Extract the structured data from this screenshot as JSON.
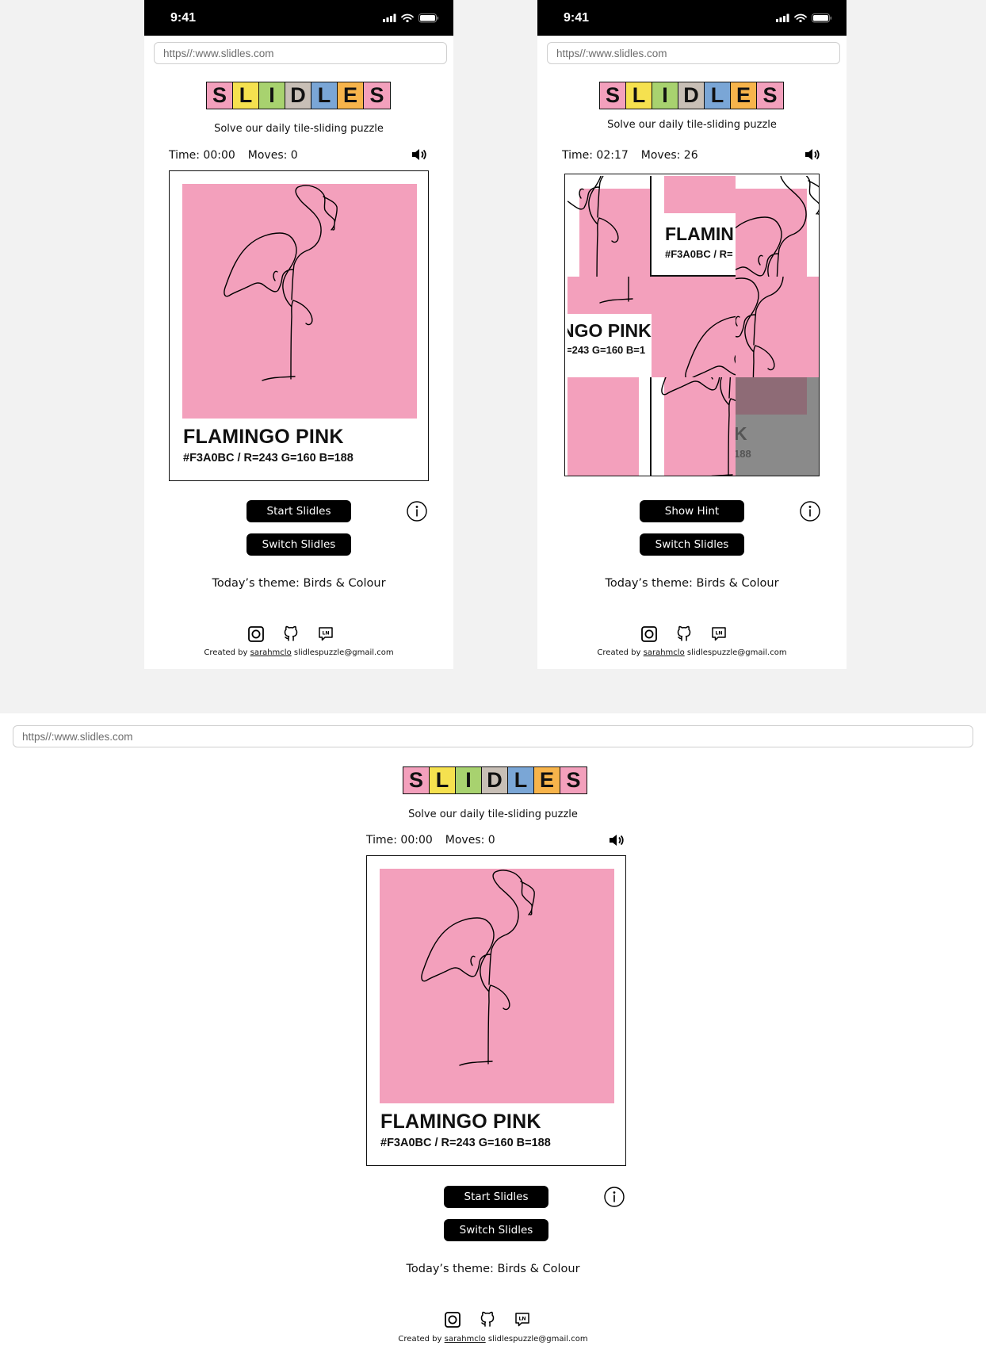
{
  "status": {
    "time": "9:41"
  },
  "url": "https//:www.slidles.com",
  "logo": [
    "S",
    "L",
    "I",
    "D",
    "L",
    "E",
    "S"
  ],
  "logo_colors": [
    "#f3a0bc",
    "#f5e14f",
    "#a8d26f",
    "#c8bfb6",
    "#7aa6d6",
    "#f7b44b",
    "#f3a0bc"
  ],
  "tagline": "Solve our daily tile-sliding puzzle",
  "screen1": {
    "time": "Time: 00:00",
    "moves": "Moves: 0",
    "primary_btn": "Start Slidles",
    "secondary_btn": "Switch Slidles"
  },
  "screen2": {
    "time": "Time: 02:17",
    "moves": "Moves: 26",
    "primary_btn": "Show Hint",
    "secondary_btn": "Switch Slidles"
  },
  "screen3": {
    "time": "Time: 00:00",
    "moves": "Moves: 0",
    "primary_btn": "Start Slidles",
    "secondary_btn": "Switch Slidles"
  },
  "card": {
    "name": "FLAMINGO PINK",
    "code": "#F3A0BC / R=243 G=160 B=188",
    "color": "#F3A0BC"
  },
  "tiles": {
    "t1": "FLAMIN",
    "t1b": "#F3A0BC / R=",
    "t2": "NGO PINK",
    "t2b": "=243 G=160 B=1",
    "t3": "K",
    "t3b": "188"
  },
  "theme": "Today’s theme: Birds & Colour",
  "credits": {
    "prefix": "Created by",
    "author": "sarahmclo",
    "email": "slidlespuzzle@gmail.com"
  },
  "icons": {
    "sound": "speaker-icon",
    "info": "info-icon",
    "instagram": "instagram-icon",
    "github": "github-icon",
    "linkedin": "linkedin-icon"
  }
}
